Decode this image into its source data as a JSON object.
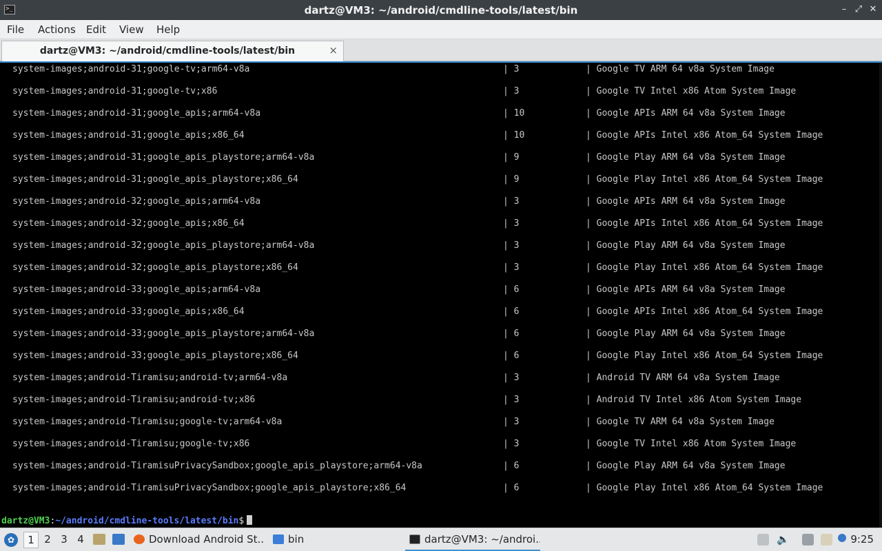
{
  "window": {
    "title": "dartz@VM3: ~/android/cmdline-tools/latest/bin",
    "controls": [
      "minimize",
      "maximize",
      "close"
    ]
  },
  "menu": [
    "File",
    "Actions",
    "Edit",
    "View",
    "Help"
  ],
  "tab": {
    "label": "dartz@VM3: ~/android/cmdline-tools/latest/bin",
    "close": "×"
  },
  "terminal": {
    "rows": [
      {
        "path": "system-images;android-31;google-tv;arm64-v8a",
        "version": "| 3",
        "desc": "| Google TV ARM 64 v8a System Image"
      },
      {
        "path": "system-images;android-31;google-tv;x86",
        "version": "| 3",
        "desc": "| Google TV Intel x86 Atom System Image"
      },
      {
        "path": "system-images;android-31;google_apis;arm64-v8a",
        "version": "| 10",
        "desc": "| Google APIs ARM 64 v8a System Image"
      },
      {
        "path": "system-images;android-31;google_apis;x86_64",
        "version": "| 10",
        "desc": "| Google APIs Intel x86 Atom_64 System Image"
      },
      {
        "path": "system-images;android-31;google_apis_playstore;arm64-v8a",
        "version": "| 9",
        "desc": "| Google Play ARM 64 v8a System Image"
      },
      {
        "path": "system-images;android-31;google_apis_playstore;x86_64",
        "version": "| 9",
        "desc": "| Google Play Intel x86 Atom_64 System Image"
      },
      {
        "path": "system-images;android-32;google_apis;arm64-v8a",
        "version": "| 3",
        "desc": "| Google APIs ARM 64 v8a System Image"
      },
      {
        "path": "system-images;android-32;google_apis;x86_64",
        "version": "| 3",
        "desc": "| Google APIs Intel x86 Atom_64 System Image"
      },
      {
        "path": "system-images;android-32;google_apis_playstore;arm64-v8a",
        "version": "| 3",
        "desc": "| Google Play ARM 64 v8a System Image"
      },
      {
        "path": "system-images;android-32;google_apis_playstore;x86_64",
        "version": "| 3",
        "desc": "| Google Play Intel x86 Atom_64 System Image"
      },
      {
        "path": "system-images;android-33;google_apis;arm64-v8a",
        "version": "| 6",
        "desc": "| Google APIs ARM 64 v8a System Image"
      },
      {
        "path": "system-images;android-33;google_apis;x86_64",
        "version": "| 6",
        "desc": "| Google APIs Intel x86 Atom_64 System Image"
      },
      {
        "path": "system-images;android-33;google_apis_playstore;arm64-v8a",
        "version": "| 6",
        "desc": "| Google Play ARM 64 v8a System Image"
      },
      {
        "path": "system-images;android-33;google_apis_playstore;x86_64",
        "version": "| 6",
        "desc": "| Google Play Intel x86 Atom_64 System Image"
      },
      {
        "path": "system-images;android-Tiramisu;android-tv;arm64-v8a",
        "version": "| 3",
        "desc": "| Android TV ARM 64 v8a System Image"
      },
      {
        "path": "system-images;android-Tiramisu;android-tv;x86",
        "version": "| 3",
        "desc": "| Android TV Intel x86 Atom System Image"
      },
      {
        "path": "system-images;android-Tiramisu;google-tv;arm64-v8a",
        "version": "| 3",
        "desc": "| Google TV ARM 64 v8a System Image"
      },
      {
        "path": "system-images;android-Tiramisu;google-tv;x86",
        "version": "| 3",
        "desc": "| Google TV Intel x86 Atom System Image"
      },
      {
        "path": "system-images;android-TiramisuPrivacySandbox;google_apis_playstore;arm64-v8a",
        "version": "| 6",
        "desc": "| Google Play ARM 64 v8a System Image"
      },
      {
        "path": "system-images;android-TiramisuPrivacySandbox;google_apis_playstore;x86_64",
        "version": "| 6",
        "desc": "| Google Play Intel x86 Atom_64 System Image"
      }
    ],
    "prompt": {
      "user": "dartz@VM3",
      "sep": ":",
      "path": "~/android/cmdline-tools/latest/bin",
      "symbol": "$"
    }
  },
  "taskbar": {
    "workspaces": [
      "1",
      "2",
      "3",
      "4"
    ],
    "tasks": [
      {
        "label": "Download Android St...",
        "icon": "firefox-icon"
      },
      {
        "label": "bin",
        "icon": "folder-icon"
      },
      {
        "label": "dartz@VM3: ~/androi...",
        "icon": "terminal-icon"
      }
    ],
    "clock": "9:25"
  },
  "colors": {
    "terminal_bg": "#000000",
    "terminal_fg": "#c8c8c8",
    "prompt_user": "#4fd14f",
    "prompt_path": "#5b7dff",
    "accent": "#3d8fd1"
  }
}
